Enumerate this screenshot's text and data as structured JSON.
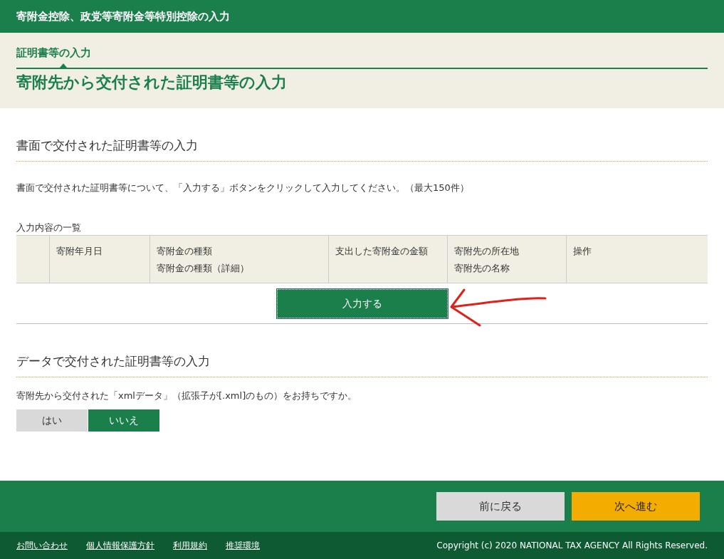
{
  "header": {
    "title": "寄附金控除、政党等寄附金等特別控除の入力"
  },
  "breadcrumb": {
    "step": "証明書等の入力"
  },
  "page_title": "寄附先から交付された証明書等の入力",
  "paper_section": {
    "heading": "書面で交付された証明書等の入力",
    "description": "書面で交付された証明書等について、「入力する」ボタンをクリックして入力してください。（最大150件）",
    "table_caption": "入力内容の一覧",
    "columns": [
      {},
      {
        "lines": [
          "寄附年月日"
        ]
      },
      {
        "lines": [
          "寄附金の種類",
          "寄附金の種類（詳細）"
        ]
      },
      {
        "lines": [
          "支出した寄附金の金額"
        ]
      },
      {
        "lines": [
          "寄附先の所在地",
          "寄附先の名称"
        ]
      },
      {
        "lines": [
          "操作"
        ]
      }
    ],
    "input_button": "入力する"
  },
  "data_section": {
    "heading": "データで交付された証明書等の入力",
    "question": "寄附先から交付された「xmlデータ」（拡張子が[.xml]のもの）をお持ちですか。",
    "options": [
      {
        "label": "はい",
        "selected": false
      },
      {
        "label": "いいえ",
        "selected": true
      }
    ]
  },
  "nav_buttons": [
    {
      "label": "前に戻る",
      "kind": "back"
    },
    {
      "label": "次へ進む",
      "kind": "next"
    }
  ],
  "footer": {
    "links": [
      "お問い合わせ",
      "個人情報保護方針",
      "利用規約",
      "推奨環境"
    ],
    "copyright": "Copyright (c) 2020 NATIONAL TAX AGENCY All Rights Reserved."
  }
}
